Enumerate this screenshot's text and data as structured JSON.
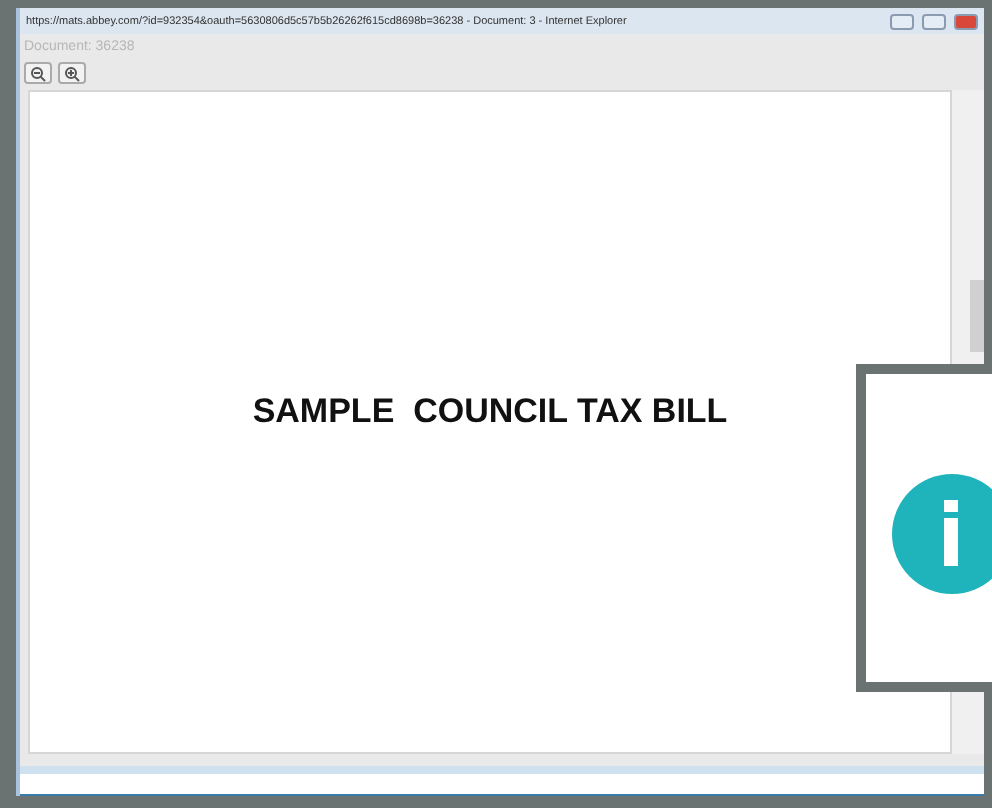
{
  "window": {
    "title": "https://mats.abbey.com/?id=932354&oauth=5630806d5c57b5b26262f615cd8698b=36238 - Document: 3 - Internet Explorer"
  },
  "document_label": "Document: 36238",
  "toolbar": [
    {
      "kind": "zoom-out"
    },
    {
      "kind": "zoom-in"
    }
  ],
  "document": {
    "heading": "SAMPLE  COUNCIL TAX BILL"
  },
  "overlay": {
    "kind": "info"
  }
}
